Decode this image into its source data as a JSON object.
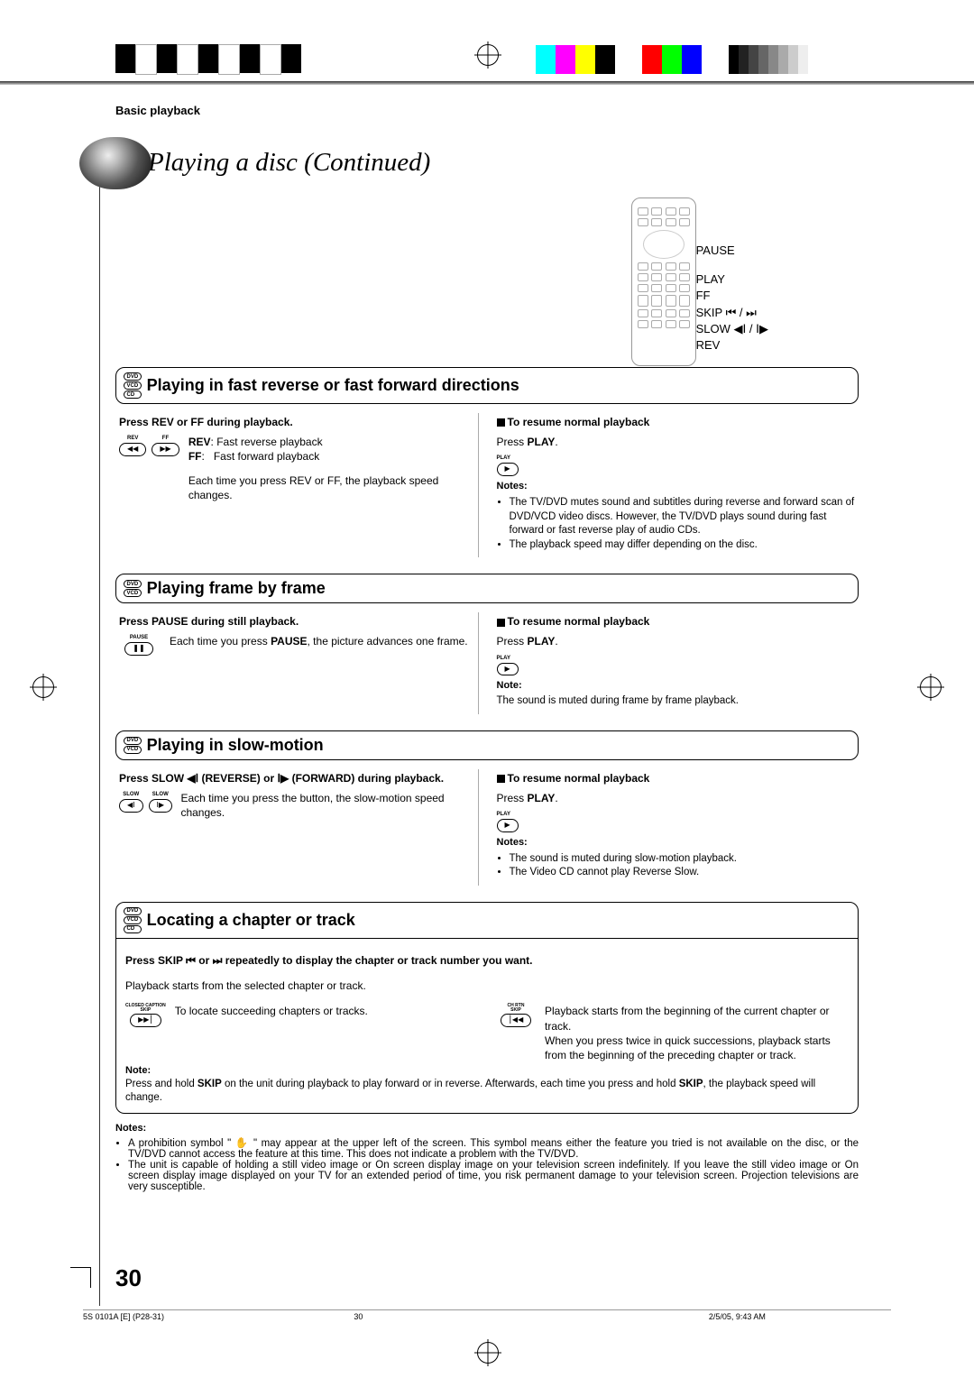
{
  "section_label": "Basic playback",
  "title": "Playing a disc (Continued)",
  "remote_labels": {
    "pause": "PAUSE",
    "play": "PLAY",
    "ff": "FF",
    "skip": "SKIP ⏮ / ⏭",
    "slow": "SLOW ◀Ⅰ / Ⅰ▶",
    "rev": "REV"
  },
  "s1": {
    "discs": [
      "DVD",
      "VCD",
      "CD"
    ],
    "title": "Playing in fast reverse or fast forward directions",
    "left_bold": "Press REV or FF during playback.",
    "rev_label": "REV",
    "rev_desc": "Fast reverse playback",
    "ff_label": "FF",
    "ff_desc": "Fast forward playback",
    "left_note": "Each time you press REV or FF, the playback speed changes.",
    "right_h": "To resume normal playback",
    "right_play": "Press PLAY.",
    "notes_label": "Notes:",
    "note1": "The TV/DVD mutes sound and subtitles during reverse and forward scan of DVD/VCD video discs. However, the TV/DVD plays sound during fast forward or fast reverse play of audio CDs.",
    "note2": "The playback speed may differ depending on the disc."
  },
  "s2": {
    "discs": [
      "DVD",
      "VCD"
    ],
    "title": "Playing frame by frame",
    "left_bold": "Press PAUSE during still playback.",
    "left_desc": "Each time you press PAUSE, the picture advances one frame.",
    "right_h": "To resume normal playback",
    "right_play": "Press PLAY.",
    "note_label": "Note:",
    "note": "The sound is muted during frame by frame playback."
  },
  "s3": {
    "discs": [
      "DVD",
      "VCD"
    ],
    "title": "Playing in slow-motion",
    "left_bold_a": "Press SLOW ◀Ⅰ (REVERSE) or Ⅰ▶ (FORWARD) during playback.",
    "left_desc": "Each time you press the button, the slow-motion speed changes.",
    "right_h": "To resume normal playback",
    "right_play": "Press PLAY.",
    "notes_label": "Notes:",
    "note1": "The sound is muted during slow-motion playback.",
    "note2": "The Video CD cannot play Reverse Slow."
  },
  "s4": {
    "discs": [
      "DVD",
      "VCD",
      "CD"
    ],
    "title": "Locating a chapter or track",
    "line1": "Press SKIP ⏮ or ⏭ repeatedly to display the chapter or track number you want.",
    "line2": "Playback starts from the selected chapter or track.",
    "ccskip_label": "CLOSED CAPTION SKIP",
    "ccskip_desc": "To locate succeeding chapters or tracks.",
    "chrtn_label": "CH RTN SKIP",
    "chrtn_a": "Playback starts from the beginning of the current chapter or track.",
    "chrtn_b": "When you press twice in quick successions, playback starts from the beginning of the preceding chapter or track.",
    "note_label": "Note:",
    "note": "Press and hold SKIP on the unit during playback to play forward or in reverse. Afterwards, each time you press and hold SKIP, the playback speed will change."
  },
  "final_notes_label": "Notes:",
  "final_note1": "A prohibition symbol \" ✋ \" may appear at the upper left of the screen. This symbol means either the feature you tried is not available on the disc, or the TV/DVD cannot access the feature at this time. This does not indicate a problem with the TV/DVD.",
  "final_note2": "The unit is capable of holding a still video image or On screen display image on your television screen indefinitely. If you leave the still video image or On screen display image displayed on your TV for an extended period of time, you risk permanent damage to your television screen. Projection televisions are very susceptible.",
  "page_number": "30",
  "footer": {
    "left": "5S 0101A [E] (P28-31)",
    "center": "30",
    "right": "2/5/05, 9:43 AM"
  }
}
